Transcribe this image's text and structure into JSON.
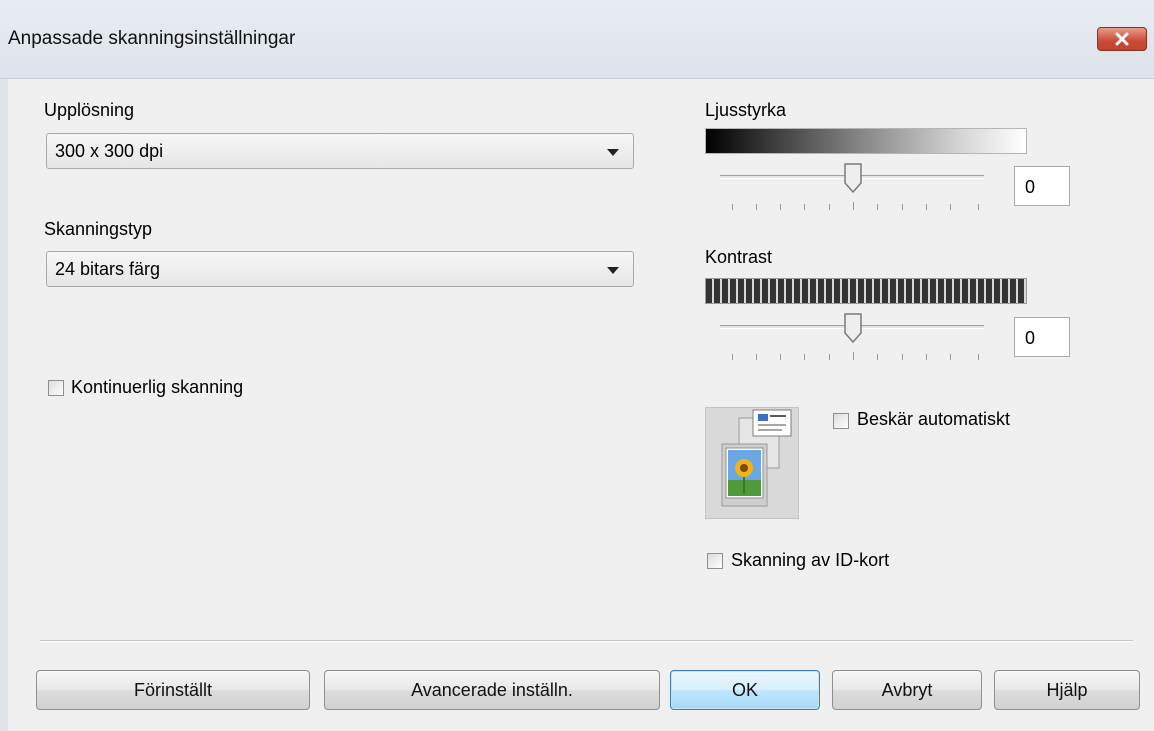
{
  "window": {
    "title": "Anpassade skanningsinställningar"
  },
  "resolution": {
    "label": "Upplösning",
    "value": "300 x 300 dpi"
  },
  "scan_type": {
    "label": "Skanningstyp",
    "value": "24 bitars färg"
  },
  "continuous_scan": {
    "label": "Kontinuerlig skanning",
    "checked": false
  },
  "brightness": {
    "label": "Ljusstyrka",
    "value": "0"
  },
  "contrast": {
    "label": "Kontrast",
    "value": "0"
  },
  "auto_crop": {
    "label": "Beskär automatiskt",
    "checked": false
  },
  "id_card_scan": {
    "label": "Skanning av ID-kort",
    "checked": false
  },
  "buttons": {
    "default": "Förinställt",
    "advanced": "Avancerade inställn.",
    "ok": "OK",
    "cancel": "Avbryt",
    "help": "Hjälp"
  },
  "colors": {
    "close_button": "#c94b36",
    "ok_button_border": "#3c7fb1"
  }
}
